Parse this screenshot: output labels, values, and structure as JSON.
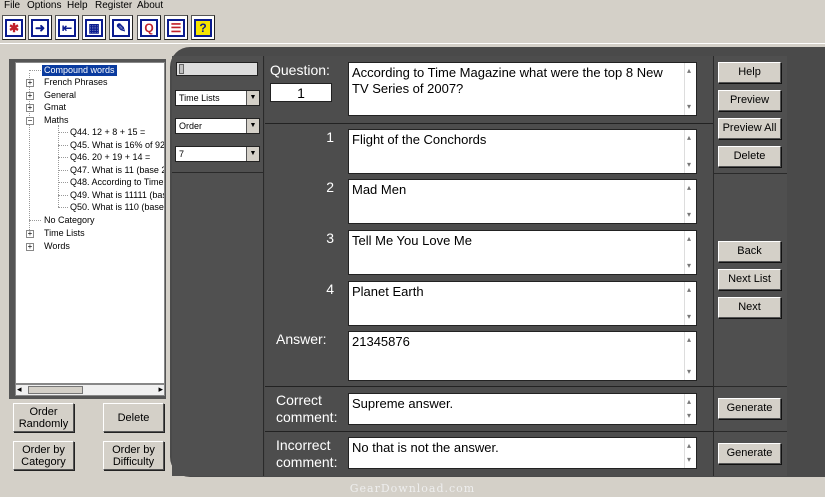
{
  "menu": [
    "File",
    "Options",
    "Help",
    "Register",
    "About"
  ],
  "toolbar": {
    "icons": [
      "new-icon",
      "save-icon",
      "open-icon",
      "grid-icon",
      "eraser-icon",
      "quiz-icon",
      "list-icon",
      "help-icon"
    ],
    "glyphs": [
      "✱",
      "➜",
      "⇤",
      "▦",
      "✎",
      "Q",
      "☰",
      "?"
    ],
    "glyph_colors": [
      "#c0202a",
      "#0a1b8f",
      "#0a1b8f",
      "#0a1b8f",
      "#0a1b8f",
      "#c0202a",
      "#c0202a",
      "#0a1b8f"
    ]
  },
  "tree": {
    "selected": "Compound words",
    "categories": [
      "French Phrases",
      "General",
      "Gmat",
      "Maths"
    ],
    "maths_items": [
      "Q44. 12 + 8 + 15 =",
      "Q45. What is 16% of 92",
      "Q46. 20 + 19 + 14 =",
      "Q47. What is 11 (base 2",
      "Q48. According to Time M",
      "Q49. What is 11111 (bas",
      "Q50. What is 110 (base"
    ],
    "no_category": "No Category",
    "more_categories": [
      "Time Lists",
      "Words"
    ]
  },
  "left_buttons": {
    "order_randomly": "Order Randomly",
    "delete": "Delete",
    "order_by_category": "Order by Category",
    "order_by_difficulty": "Order by Difficulty"
  },
  "filters": {
    "list": "Time Lists",
    "type": "Order",
    "count": "7"
  },
  "question": {
    "label": "Question:",
    "number": "1",
    "text": "According to Time Magazine what were the top 8 New TV Series of 2007?"
  },
  "options": [
    {
      "num": "1",
      "text": "Flight of the Conchords"
    },
    {
      "num": "2",
      "text": "Mad Men"
    },
    {
      "num": "3",
      "text": "Tell Me You Love Me"
    },
    {
      "num": "4",
      "text": "Planet Earth"
    }
  ],
  "answer": {
    "label": "Answer:",
    "text": "21345876"
  },
  "correct": {
    "label_line1": "Correct",
    "label_line2": "comment:",
    "text": "Supreme answer."
  },
  "incorrect": {
    "label_line1": "Incorrect",
    "label_line2": "comment:",
    "text": "No that is not the answer."
  },
  "right_buttons": {
    "help": "Help",
    "preview": "Preview",
    "preview_all": "Preview All",
    "delete": "Delete",
    "back": "Back",
    "next_list": "Next List",
    "next": "Next",
    "generate_correct": "Generate",
    "generate_incorrect": "Generate"
  },
  "watermark": "GearDownload.com"
}
